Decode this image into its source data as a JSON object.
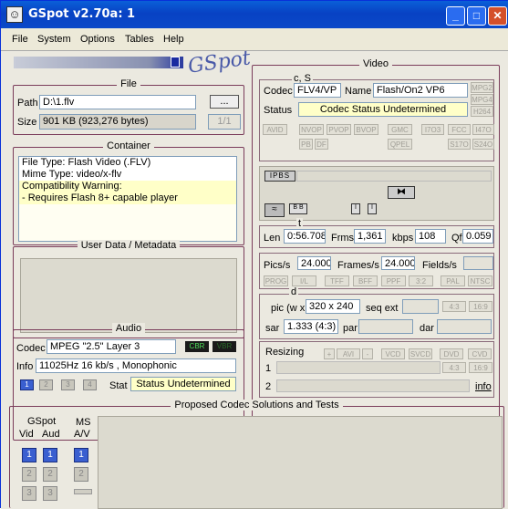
{
  "window": {
    "title": "GSpot v2.70a: 1",
    "logo": "GSpot"
  },
  "menu": [
    "File",
    "System",
    "Options",
    "Tables",
    "Help"
  ],
  "file": {
    "legend": "File",
    "path_label": "Path",
    "path_value": "D:\\1.flv",
    "browse_label": "...",
    "size_label": "Size",
    "size_value": "901 KB (923,276 bytes)",
    "count_value": "1/1"
  },
  "container": {
    "legend": "Container",
    "lines": [
      "File Type: Flash Video (.FLV)",
      "Mime Type: video/x-flv",
      "Compatibility Warning:",
      "- Requires Flash 8+ capable player"
    ]
  },
  "userdata": {
    "legend": "User Data / Metadata"
  },
  "audio": {
    "legend": "Audio",
    "codec_label": "Codec",
    "codec_value": "MPEG \"2.5\" Layer 3",
    "cbr": "CBR",
    "vbr": "VBR",
    "info_label": "Info",
    "info_value": "11025Hz  16 kb/s , Monophonic",
    "stream_buttons": [
      "1",
      "2",
      "3",
      "4"
    ],
    "stat_label": "Stat",
    "stat_value": "Status Undetermined"
  },
  "video": {
    "legend": "Video",
    "cs_label": "c, S",
    "codec_label": "Codec",
    "codec_value": "FLV4/VP",
    "name_label": "Name",
    "name_value": "Flash/On2 VP6",
    "status_label": "Status",
    "status_value": "Codec Status Undetermined",
    "side_flags": [
      "MPG2",
      "MPG4",
      "H264"
    ],
    "flags_row1": [
      "AVID",
      "NVOP",
      "PVOP",
      "BVOP",
      "GMC",
      "I7O3",
      "FCC",
      "I47O"
    ],
    "flags_row2": [
      "PB",
      "DF",
      "QPEL",
      "S17O",
      "S24O"
    ],
    "ipbs": "IPBS",
    "t_label": "t",
    "len_label": "Len",
    "len_value": "0:56.708",
    "frms_label": "Frms",
    "frms_value": "1,361",
    "kbps_label": "kbps",
    "kbps_value": "108",
    "qf_label": "Qf",
    "qf_value": "0.059",
    "pics_label": "Pics/s",
    "pics_value": "24.000",
    "frames_label": "Frames/s",
    "frames_value": "24.000",
    "fields_label": "Fields/s",
    "flags_row3": [
      "PROG",
      "I/L",
      "TFF",
      "BFF",
      "PPF",
      "3:2",
      "PAL",
      "NTSC"
    ],
    "d_label": "d",
    "pic_label": "pic (w x",
    "pic_value": "320 x 240",
    "seqext_label": "seq ext",
    "seqext_btns": [
      "4:3",
      "16:9"
    ],
    "sar_label": "sar",
    "sar_value": "1.333 (4:3)",
    "par_label": "par",
    "dar_label": "dar",
    "resizing_label": "Resizing",
    "resize_btns": [
      "+",
      "AVI",
      "-",
      "VCD",
      "SVCD",
      "DVD",
      "CVD"
    ],
    "row1_label": "1",
    "row2_label": "2",
    "row1_btns": [
      "4:3",
      "16:9"
    ],
    "info_link": "info"
  },
  "proposed": {
    "legend": "Proposed Codec Solutions and Tests",
    "gspot_label": "GSpot",
    "vid_label": "Vid",
    "aud_label": "Aud",
    "ms_label": "MS",
    "av_label": "A/V",
    "num_buttons": [
      "1",
      "2",
      "3"
    ]
  },
  "colors": {
    "title_bar": "#0a5fd8",
    "frame": "#7a3c5a",
    "highlight": "#ffffc8",
    "active_button": "#3a5fd0"
  }
}
